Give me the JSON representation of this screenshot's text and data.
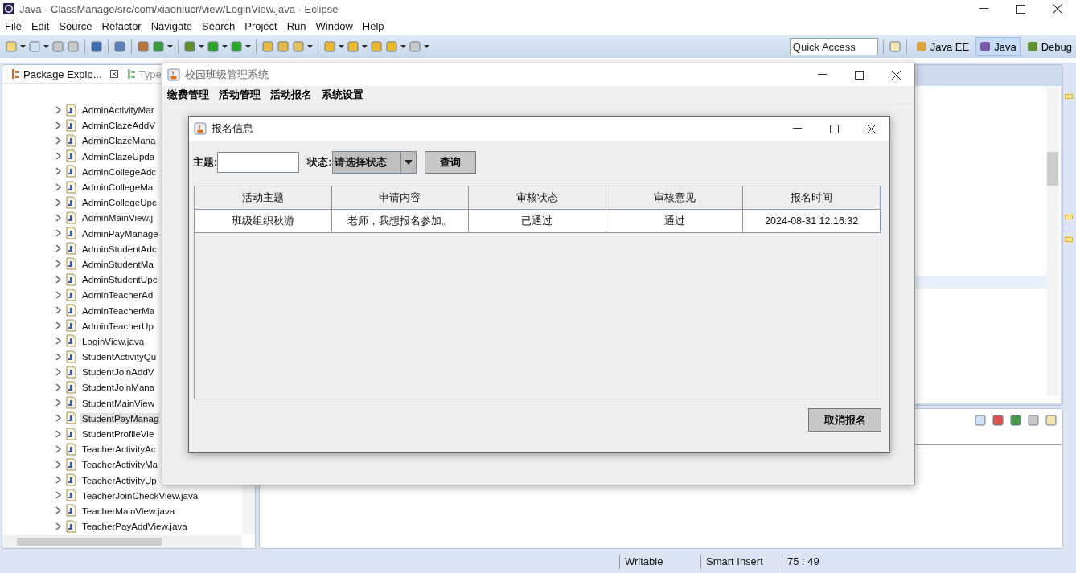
{
  "eclipse": {
    "title": "Java - ClassManage/src/com/xiaoniucr/view/LoginView.java - Eclipse",
    "menu": [
      "File",
      "Edit",
      "Source",
      "Refactor",
      "Navigate",
      "Search",
      "Project",
      "Run",
      "Window",
      "Help"
    ],
    "quick_access": {
      "placeholder": "Quick Access"
    },
    "perspectives": [
      {
        "label": "Java EE",
        "selected": false
      },
      {
        "label": "Java",
        "selected": true
      },
      {
        "label": "Debug",
        "selected": false
      }
    ],
    "package_explorer": {
      "tabs": [
        {
          "label": "Package Explo...",
          "selected": true
        },
        {
          "label": "Type",
          "selected": false
        }
      ],
      "items": [
        {
          "name": "AdminActivityMar",
          "selected": false
        },
        {
          "name": "AdminClazeAddV",
          "selected": false
        },
        {
          "name": "AdminClazeMana",
          "selected": false
        },
        {
          "name": "AdminClazeUpda",
          "selected": false
        },
        {
          "name": "AdminCollegeAdc",
          "selected": false
        },
        {
          "name": "AdminCollegeMa",
          "selected": false
        },
        {
          "name": "AdminCollegeUpc",
          "selected": false
        },
        {
          "name": "AdminMainView.j",
          "selected": false
        },
        {
          "name": "AdminPayManage",
          "selected": false
        },
        {
          "name": "AdminStudentAdc",
          "selected": false
        },
        {
          "name": "AdminStudentMa",
          "selected": false
        },
        {
          "name": "AdminStudentUpc",
          "selected": false
        },
        {
          "name": "AdminTeacherAd",
          "selected": false
        },
        {
          "name": "AdminTeacherMa",
          "selected": false
        },
        {
          "name": "AdminTeacherUp",
          "selected": false
        },
        {
          "name": "LoginView.java",
          "selected": false
        },
        {
          "name": "StudentActivityQu",
          "selected": false
        },
        {
          "name": "StudentJoinAddV",
          "selected": false
        },
        {
          "name": "StudentJoinMana",
          "selected": false
        },
        {
          "name": "StudentMainView",
          "selected": false
        },
        {
          "name": "StudentPayManag",
          "selected": true
        },
        {
          "name": "StudentProfileVie",
          "selected": false
        },
        {
          "name": "TeacherActivityAc",
          "selected": false
        },
        {
          "name": "TeacherActivityMa",
          "selected": false
        },
        {
          "name": "TeacherActivityUp",
          "selected": false
        },
        {
          "name": "TeacherJoinCheckView.java",
          "selected": false
        },
        {
          "name": "TeacherMainView.java",
          "selected": false
        },
        {
          "name": "TeacherPayAddView.java",
          "selected": false
        }
      ]
    },
    "status_bar": [
      "Writable",
      "Smart Insert",
      "75 : 49"
    ]
  },
  "app": {
    "title": "校园班级管理系统",
    "menu": [
      "缴费管理",
      "活动管理",
      "活动报名",
      "系统设置"
    ],
    "dialog": {
      "title": "报名信息",
      "subject_label": "主题:",
      "status_label": "状态:",
      "status_select": "请选择状态",
      "query_button": "查询",
      "table": {
        "columns": [
          "活动主题",
          "申请内容",
          "审核状态",
          "审核意见",
          "报名时间"
        ],
        "rows": [
          [
            "班级组织秋游",
            "老师，我想报名参加。",
            "已通过",
            "通过",
            "2024-08-31 12:16:32"
          ]
        ]
      },
      "cancel_button": "取消报名"
    }
  }
}
